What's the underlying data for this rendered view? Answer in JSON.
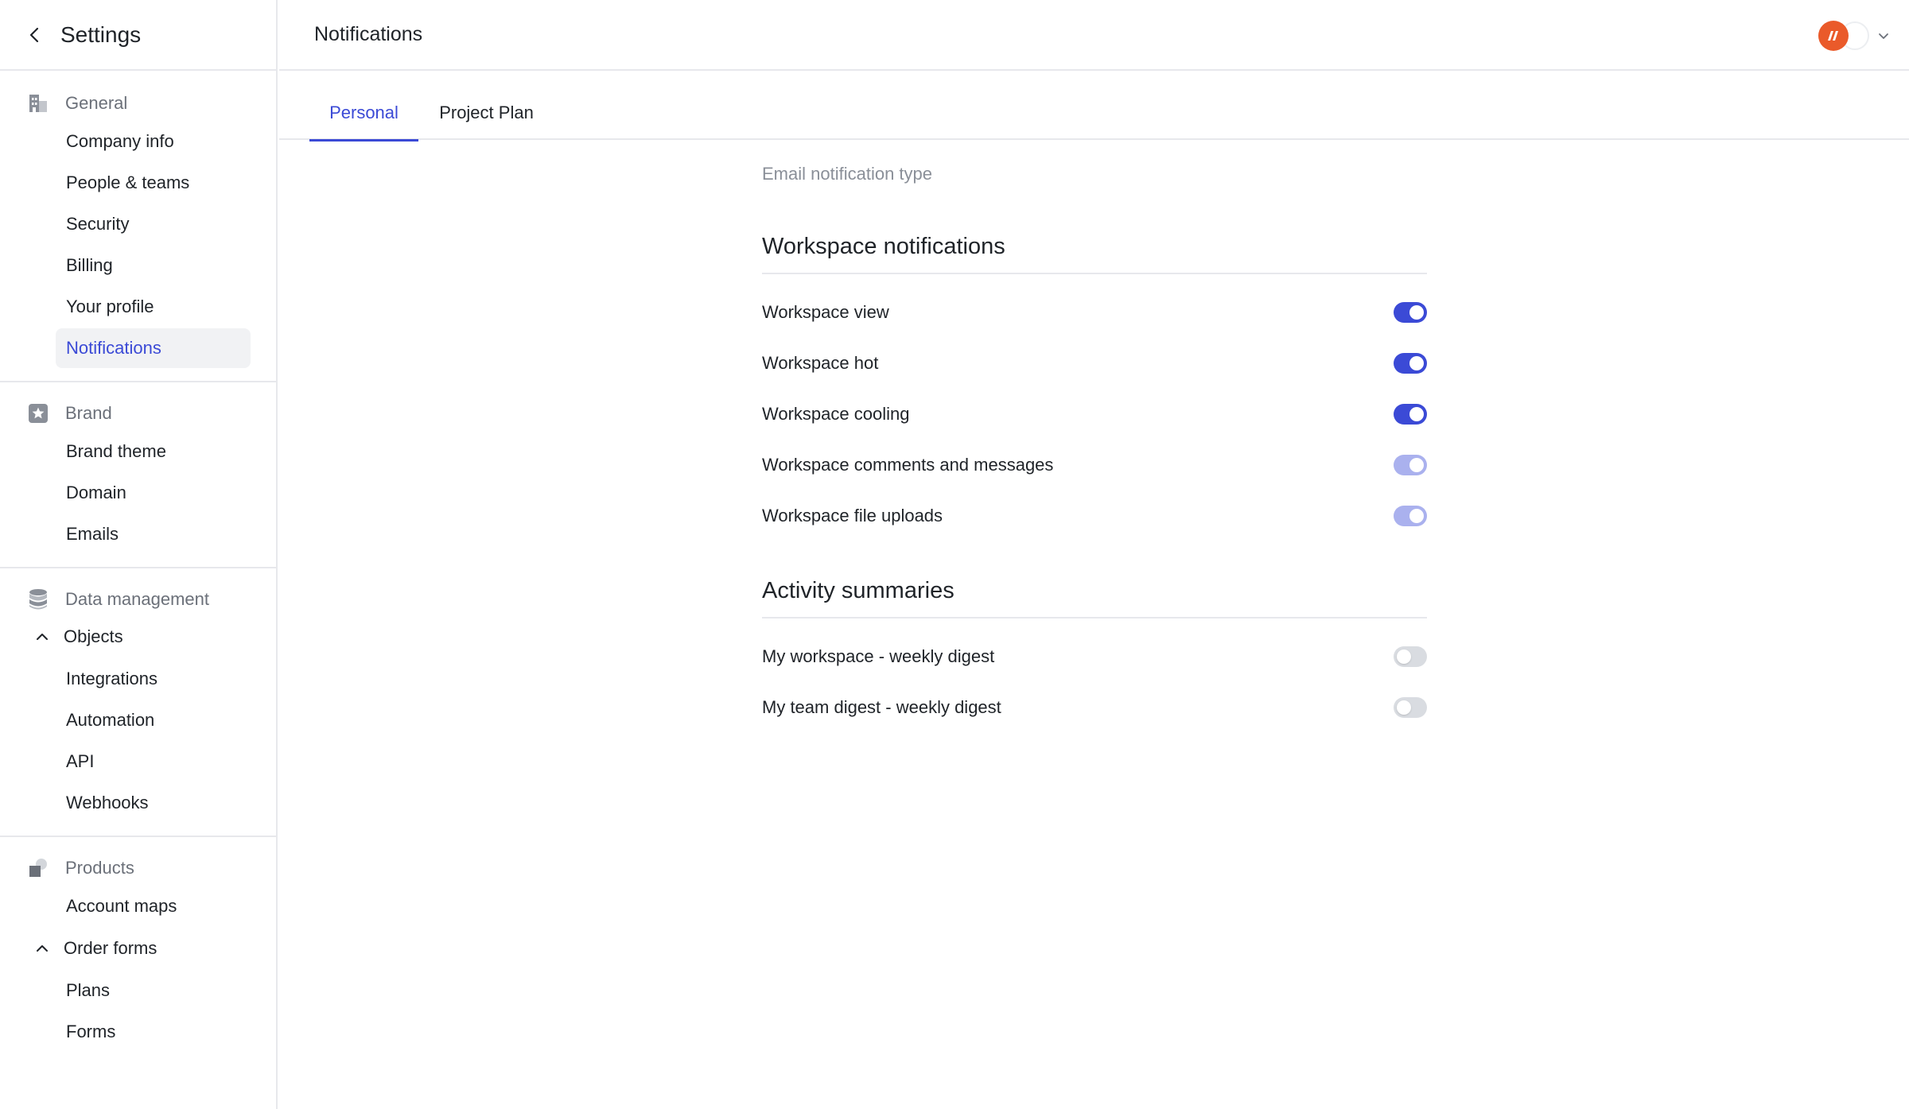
{
  "sidebar": {
    "title": "Settings",
    "sections": [
      {
        "label": "General",
        "icon": "building-icon",
        "items": [
          "Company info",
          "People & teams",
          "Security",
          "Billing",
          "Your profile",
          "Notifications"
        ]
      },
      {
        "label": "Brand",
        "icon": "star-badge-icon",
        "items": [
          "Brand theme",
          "Domain",
          "Emails"
        ]
      },
      {
        "label": "Data management",
        "icon": "database-icon",
        "group": "Objects",
        "items": [
          "Integrations",
          "Automation",
          "API",
          "Webhooks"
        ]
      },
      {
        "label": "Products",
        "icon": "box-icon",
        "items": [
          "Account maps"
        ],
        "group": "Order forms",
        "subitems": [
          "Plans",
          "Forms"
        ]
      }
    ],
    "active_item": "Notifications"
  },
  "header": {
    "title": "Notifications"
  },
  "tabs": [
    {
      "label": "Personal",
      "active": true
    },
    {
      "label": "Project Plan",
      "active": false
    }
  ],
  "main": {
    "email_notification_type_label": "Email notification type",
    "workspace": {
      "title": "Workspace notifications",
      "rows": [
        {
          "label": "Workspace view",
          "state": "on"
        },
        {
          "label": "Workspace hot",
          "state": "on"
        },
        {
          "label": "Workspace cooling",
          "state": "on"
        },
        {
          "label": "Workspace comments and messages",
          "state": "on-disabled"
        },
        {
          "label": "Workspace file uploads",
          "state": "on-disabled"
        }
      ]
    },
    "activity": {
      "title": "Activity summaries",
      "rows": [
        {
          "label": "My workspace - weekly digest",
          "state": "off"
        },
        {
          "label": "My team digest - weekly digest",
          "state": "off"
        }
      ]
    }
  },
  "colors": {
    "accent": "#3b4ad6",
    "toggle_on": "#3b4ad6",
    "toggle_disabled": "#aab1ee",
    "toggle_off": "#d9dce1",
    "brand_logo": "#ea5a2a"
  }
}
